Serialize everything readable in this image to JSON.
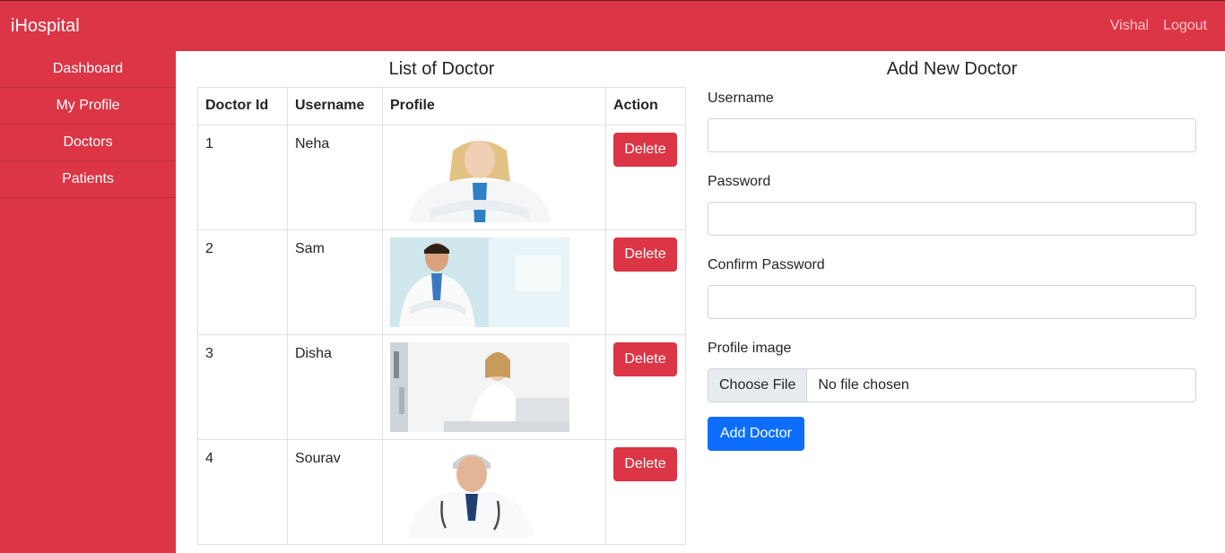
{
  "app": {
    "brand": "iHospital"
  },
  "header": {
    "user": "Vishal",
    "logout": "Logout"
  },
  "sidebar": {
    "items": [
      {
        "label": "Dashboard"
      },
      {
        "label": "My Profile"
      },
      {
        "label": "Doctors"
      },
      {
        "label": "Patients"
      }
    ]
  },
  "list": {
    "title": "List of Doctor",
    "columns": [
      "Doctor Id",
      "Username",
      "Profile",
      "Action"
    ],
    "rows": [
      {
        "id": "1",
        "username": "Neha",
        "action": "Delete"
      },
      {
        "id": "2",
        "username": "Sam",
        "action": "Delete"
      },
      {
        "id": "3",
        "username": "Disha",
        "action": "Delete"
      },
      {
        "id": "4",
        "username": "Sourav",
        "action": "Delete"
      }
    ]
  },
  "form": {
    "title": "Add New Doctor",
    "username_label": "Username",
    "password_label": "Password",
    "confirm_label": "Confirm Password",
    "image_label": "Profile image",
    "choose_file": "Choose File",
    "no_file": "No file chosen",
    "submit": "Add Doctor"
  },
  "colors": {
    "primary_red": "#dc3545",
    "button_blue": "#0d6efd"
  }
}
